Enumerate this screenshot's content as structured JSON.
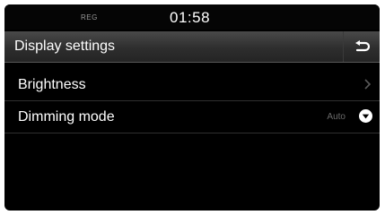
{
  "status": {
    "reg_label": "REG",
    "clock": "01:58"
  },
  "header": {
    "title": "Display settings",
    "back_icon": "return-arrow-icon"
  },
  "settings": {
    "items": [
      {
        "label": "Brightness",
        "value": "",
        "icon": "chevron-right-icon"
      },
      {
        "label": "Dimming mode",
        "value": "Auto",
        "icon": "dropdown-circle-icon"
      }
    ]
  },
  "colors": {
    "background": "#000000",
    "text": "#ffffff",
    "muted": "#6a6a6a"
  }
}
